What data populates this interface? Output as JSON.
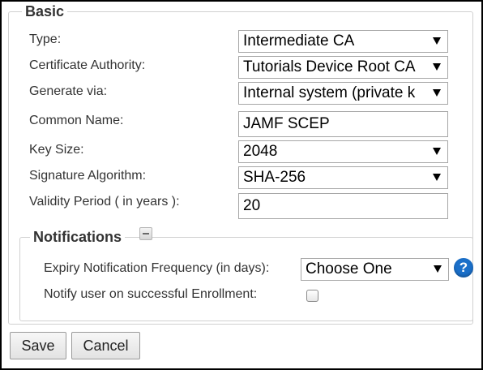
{
  "basic": {
    "legend": "Basic",
    "type": {
      "label": "Type:",
      "value": "Intermediate CA"
    },
    "certificate_authority": {
      "label": "Certificate Authority:",
      "value": "Tutorials Device Root CA"
    },
    "generate_via": {
      "label": "Generate via:",
      "value": "Internal system (private k"
    },
    "common_name": {
      "label": "Common Name:",
      "value": "JAMF SCEP"
    },
    "key_size": {
      "label": "Key Size:",
      "value": "2048"
    },
    "signature_algorithm": {
      "label": "Signature Algorithm:",
      "value": "SHA-256"
    },
    "validity_period": {
      "label": "Validity Period ( in years ):",
      "value": "20"
    }
  },
  "notifications": {
    "legend": "Notifications",
    "expiry_frequency": {
      "label": "Expiry Notification Frequency (in days):",
      "value": "Choose One"
    },
    "notify_enrollment": {
      "label": "Notify user on successful Enrollment:",
      "checked": false
    }
  },
  "help_icon": {
    "glyph": "?",
    "icon": "help-icon",
    "color": "#1a6fc9"
  },
  "actions": {
    "save_label": "Save",
    "cancel_label": "Cancel"
  }
}
